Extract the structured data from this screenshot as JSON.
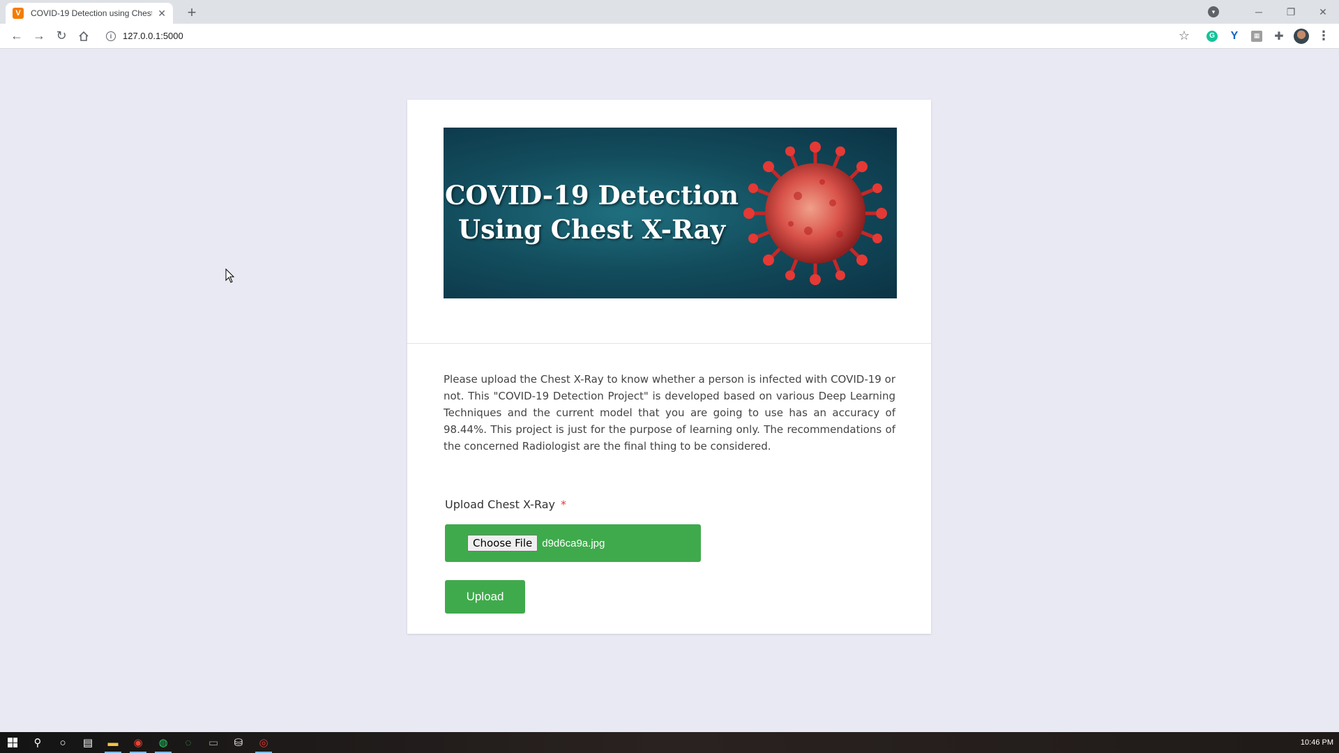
{
  "browser": {
    "tab_title": "COVID-19 Detection using Chest",
    "favicon_letter": "V",
    "url": "127.0.0.1:5000"
  },
  "page": {
    "banner_line1": "COVID-19 Detection",
    "banner_line2": "Using Chest X-Ray",
    "description": "Please upload the Chest X-Ray to know whether a person is infected with COVID-19 or not. This \"COVID-19 Detection Project\" is developed based on various Deep Learning Techniques and the current model that you are going to use has an accuracy of 98.44%. This project is just for the purpose of learning only. The recommendations of the concerned Radiologist are the final thing to be considered.",
    "upload_label": "Upload Chest X-Ray",
    "required_mark": "*",
    "choose_file_label": "Choose File",
    "file_name": "d9d6ca9a.jpg",
    "upload_button": "Upload"
  },
  "taskbar": {
    "clock": "10:46 PM"
  },
  "colors": {
    "accent_green": "#3faa4c",
    "page_background": "#e8e9f3",
    "banner_teal": "#134e5e",
    "required_red": "#e53935"
  }
}
